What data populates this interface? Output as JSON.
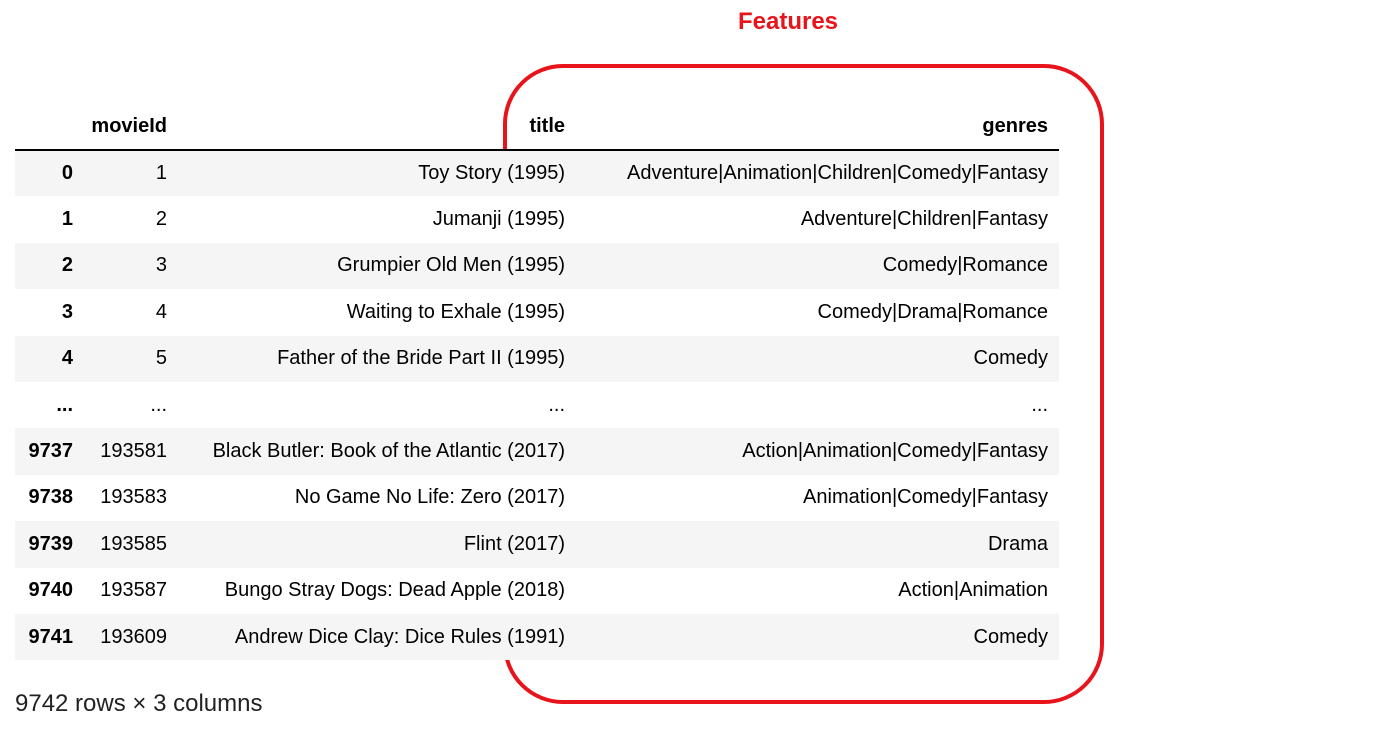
{
  "annotation": {
    "label": "Features",
    "color": "#e8141c"
  },
  "dataframe": {
    "columns": [
      "movieId",
      "title",
      "genres"
    ],
    "rows": [
      {
        "index": "0",
        "movieId": "1",
        "title": "Toy Story (1995)",
        "genres": "Adventure|Animation|Children|Comedy|Fantasy"
      },
      {
        "index": "1",
        "movieId": "2",
        "title": "Jumanji (1995)",
        "genres": "Adventure|Children|Fantasy"
      },
      {
        "index": "2",
        "movieId": "3",
        "title": "Grumpier Old Men (1995)",
        "genres": "Comedy|Romance"
      },
      {
        "index": "3",
        "movieId": "4",
        "title": "Waiting to Exhale (1995)",
        "genres": "Comedy|Drama|Romance"
      },
      {
        "index": "4",
        "movieId": "5",
        "title": "Father of the Bride Part II (1995)",
        "genres": "Comedy"
      },
      {
        "index": "...",
        "movieId": "...",
        "title": "...",
        "genres": "..."
      },
      {
        "index": "9737",
        "movieId": "193581",
        "title": "Black Butler: Book of the Atlantic (2017)",
        "genres": "Action|Animation|Comedy|Fantasy"
      },
      {
        "index": "9738",
        "movieId": "193583",
        "title": "No Game No Life: Zero (2017)",
        "genres": "Animation|Comedy|Fantasy"
      },
      {
        "index": "9739",
        "movieId": "193585",
        "title": "Flint (2017)",
        "genres": "Drama"
      },
      {
        "index": "9740",
        "movieId": "193587",
        "title": "Bungo Stray Dogs: Dead Apple (2018)",
        "genres": "Action|Animation"
      },
      {
        "index": "9741",
        "movieId": "193609",
        "title": "Andrew Dice Clay: Dice Rules (1991)",
        "genres": "Comedy"
      }
    ],
    "shape": "9742 rows × 3 columns"
  }
}
